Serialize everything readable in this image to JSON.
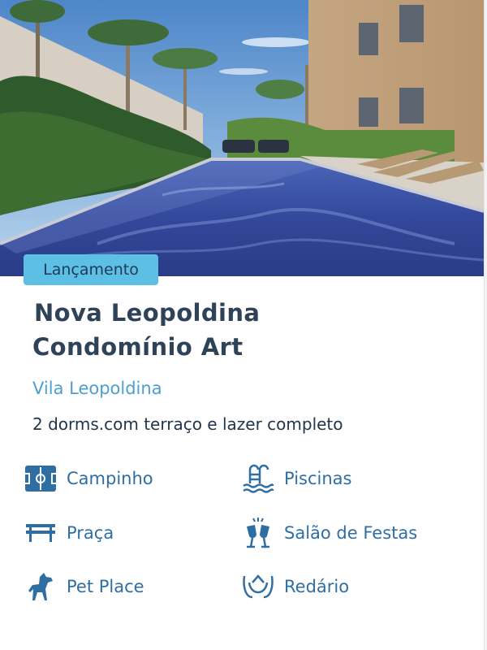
{
  "card": {
    "badge": "Lançamento",
    "title_line1": "Nova Leopoldina",
    "title_line2": "Condomínio Art",
    "neighborhood": "Vila Leopoldina",
    "description": "2 dorms.com terraço e lazer completo",
    "amenities": [
      {
        "label": "Campinho",
        "icon": "soccer-field-icon"
      },
      {
        "label": "Piscinas",
        "icon": "pool-icon"
      },
      {
        "label": "Praça",
        "icon": "bench-icon"
      },
      {
        "label": "Salão de Festas",
        "icon": "party-toast-icon"
      },
      {
        "label": "Pet Place",
        "icon": "dog-icon"
      },
      {
        "label": "Redário",
        "icon": "hammock-icon"
      }
    ]
  },
  "colors": {
    "badge_bg": "#5dbfe3",
    "title": "#2e4258",
    "neighborhood": "#4b9fd1",
    "icon": "#2f6ea3"
  }
}
